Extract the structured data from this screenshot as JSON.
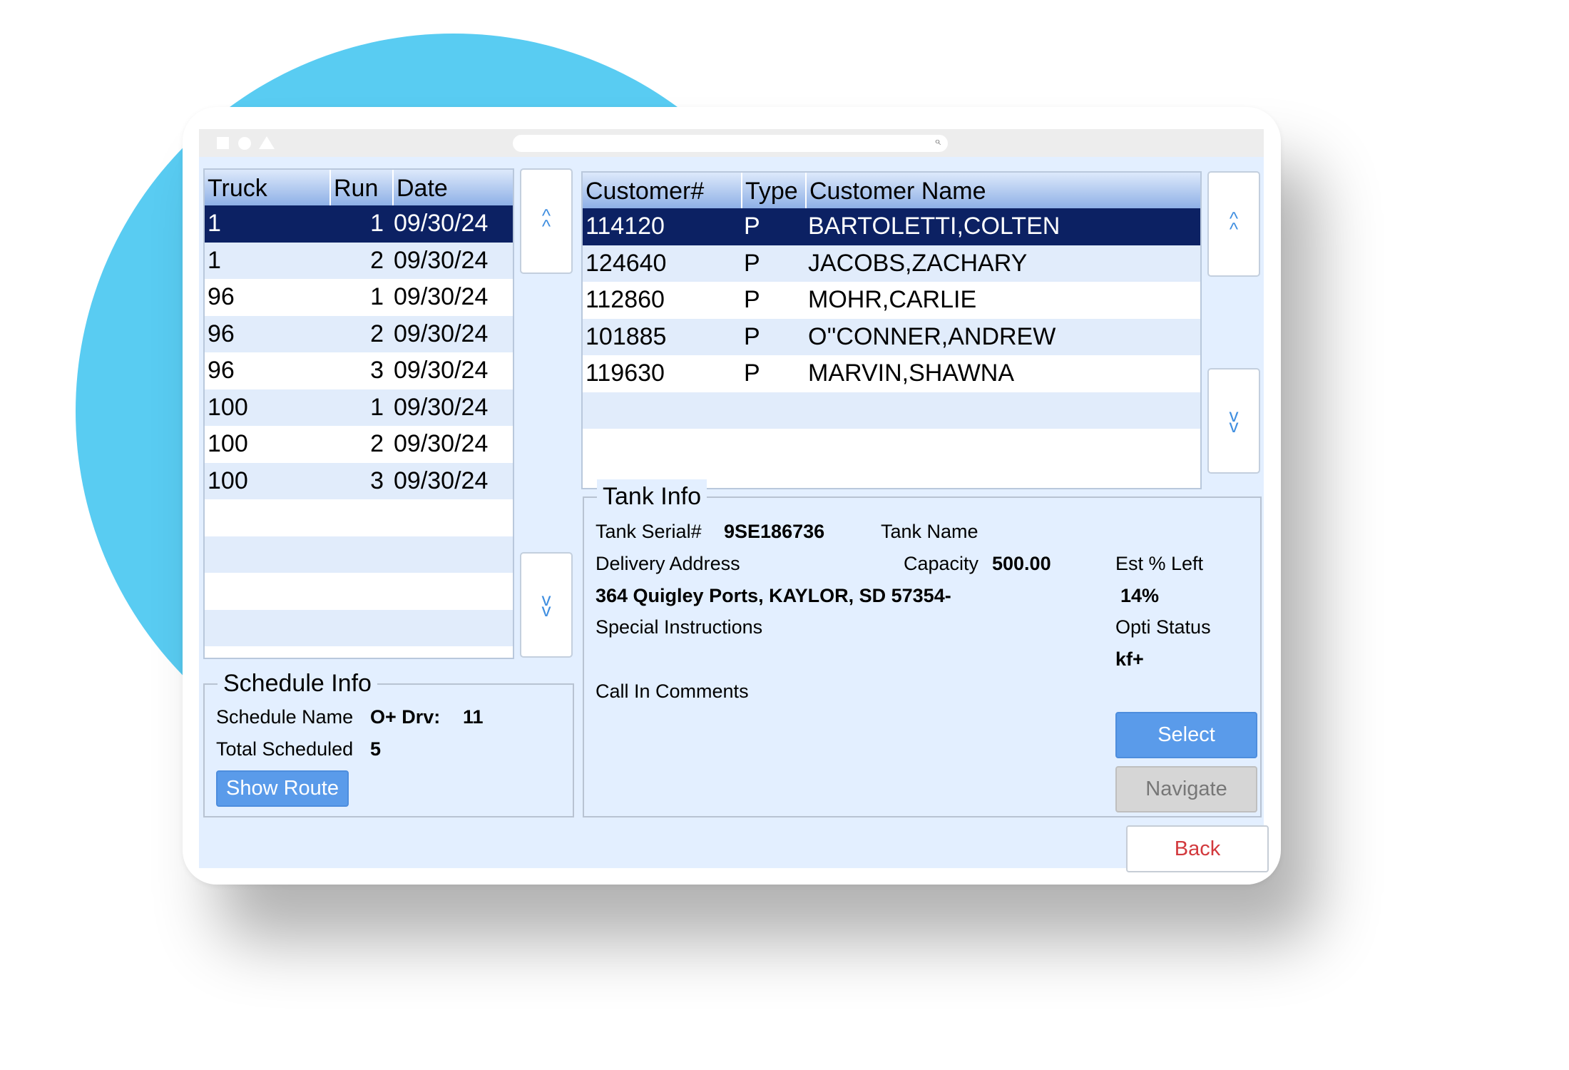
{
  "window": {
    "url": ""
  },
  "runs_table": {
    "columns": [
      "Truck",
      "Run",
      "Date"
    ],
    "rows": [
      {
        "truck": "1",
        "run": "1",
        "date": "09/30/24"
      },
      {
        "truck": "1",
        "run": "2",
        "date": "09/30/24"
      },
      {
        "truck": "96",
        "run": "1",
        "date": "09/30/24"
      },
      {
        "truck": "96",
        "run": "2",
        "date": "09/30/24"
      },
      {
        "truck": "96",
        "run": "3",
        "date": "09/30/24"
      },
      {
        "truck": "100",
        "run": "1",
        "date": "09/30/24"
      },
      {
        "truck": "100",
        "run": "2",
        "date": "09/30/24"
      },
      {
        "truck": "100",
        "run": "3",
        "date": "09/30/24"
      }
    ],
    "selected_index": 0
  },
  "customers_table": {
    "columns": [
      "Customer#",
      "Type",
      "Customer Name"
    ],
    "rows": [
      {
        "number": "114120",
        "type": "P",
        "name": "BARTOLETTI,COLTEN"
      },
      {
        "number": "124640",
        "type": "P",
        "name": "JACOBS,ZACHARY"
      },
      {
        "number": "112860",
        "type": "P",
        "name": "MOHR,CARLIE"
      },
      {
        "number": "101885",
        "type": "P",
        "name": "O''CONNER,ANDREW"
      },
      {
        "number": "119630",
        "type": "P",
        "name": "MARVIN,SHAWNA"
      }
    ],
    "selected_index": 0
  },
  "schedule_info": {
    "title": "Schedule Info",
    "schedule_name_label": "Schedule Name",
    "schedule_name_value": "O+ Drv:",
    "schedule_name_number": "11",
    "total_label": "Total Scheduled",
    "total_value": "5",
    "show_route_label": "Show Route"
  },
  "tank_info": {
    "title": "Tank Info",
    "serial_label": "Tank Serial#",
    "serial_value": "9SE186736",
    "tank_name_label": "Tank Name",
    "delivery_address_label": "Delivery Address",
    "address_value": "364 Quigley Ports, KAYLOR, SD 57354-",
    "capacity_label": "Capacity",
    "capacity_value": "500.00",
    "est_left_label": "Est % Left",
    "est_left_value": "14%",
    "special_instructions_label": "Special Instructions",
    "opti_status_label": "Opti Status",
    "opti_status_value": "kf+",
    "call_in_label": "Call In Comments",
    "select_label": "Select",
    "navigate_label": "Navigate"
  },
  "back_label": "Back",
  "icons": {
    "scroll_up": "double-chevron-up-icon",
    "scroll_down": "double-chevron-down-icon",
    "search": "search-icon"
  },
  "colors": {
    "selected_row": "#0c2163",
    "accent_button": "#5a9bea",
    "back_text": "#d2393d",
    "background_circle": "#59ccf2"
  }
}
